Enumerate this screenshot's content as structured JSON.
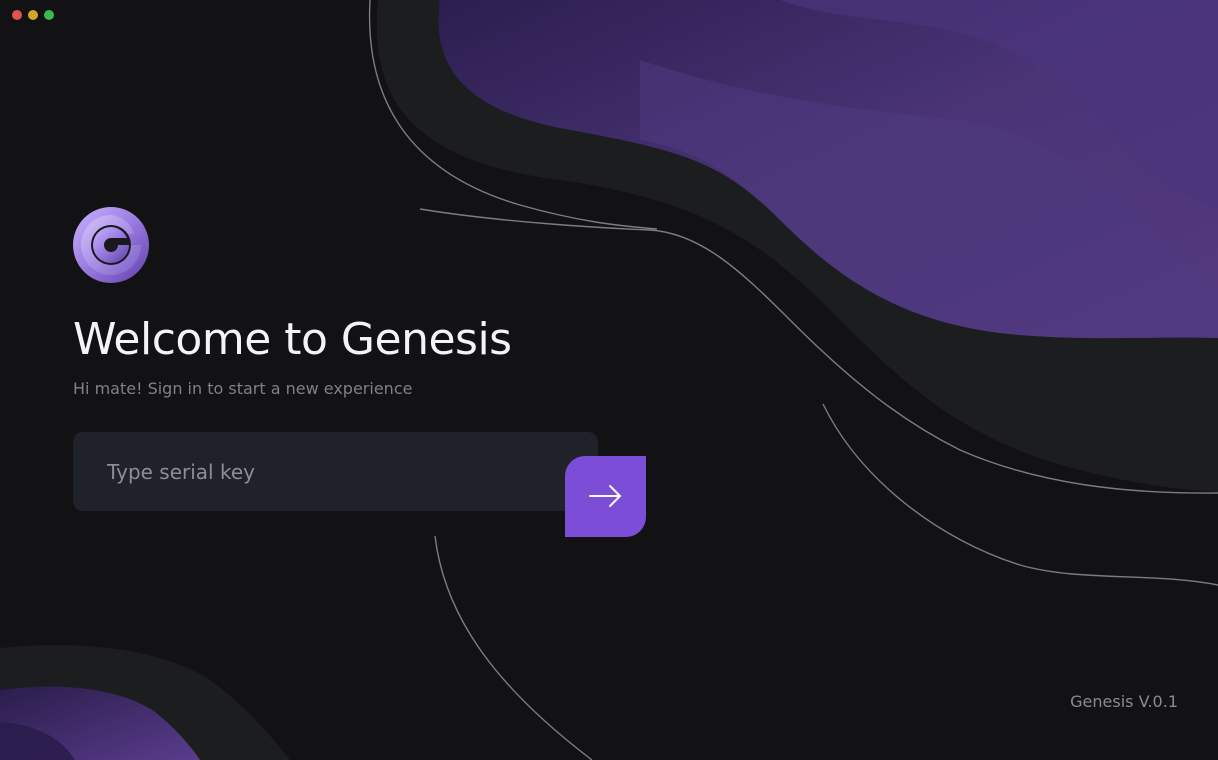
{
  "window": {
    "controls": [
      {
        "name": "close",
        "color": "#e0544f"
      },
      {
        "name": "minimize",
        "color": "#d3a52b"
      },
      {
        "name": "zoom",
        "color": "#3cb94c"
      }
    ]
  },
  "brand": {
    "logo_icon": "genesis-g-logo",
    "accent": "#7c4dd6"
  },
  "login": {
    "title": "Welcome to Genesis",
    "subtitle": "Hi mate! Sign in to start a new experience",
    "serial_placeholder": "Type serial key",
    "serial_value": "",
    "submit_icon": "arrow-right-icon"
  },
  "footer": {
    "version": "Genesis V.0.1"
  }
}
